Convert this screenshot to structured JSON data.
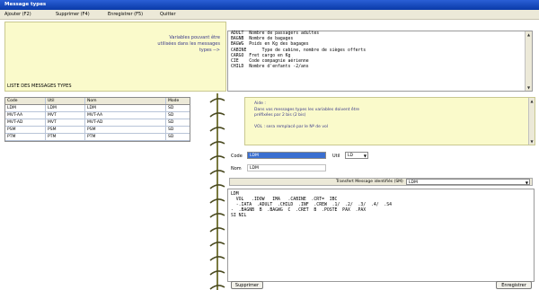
{
  "window": {
    "title": "Message types"
  },
  "menu": [
    "Ajouter (F2)",
    "Supprimer (F4)",
    "Enregistrer (F5)",
    "Quitter"
  ],
  "info": {
    "text_lines": [
      "Variables pouvant être",
      "utilisées dans les messages",
      "types -->"
    ],
    "list_label": "LISTE DES MESSAGES TYPES"
  },
  "grid": {
    "headers": [
      "Code",
      "Util",
      "Nom",
      "Mode"
    ],
    "rows": [
      [
        "LDM",
        "LDM",
        "LDM",
        "SD"
      ],
      [
        "MVT-AA",
        "MVT",
        "MVT-AA",
        "SD"
      ],
      [
        "MVT-AD",
        "MVT",
        "MVT-AD",
        "SD"
      ],
      [
        "PSM",
        "PSM",
        "PSM",
        "SD"
      ],
      [
        "PTM",
        "PTM",
        "PTM",
        "SD"
      ]
    ]
  },
  "variables": [
    "ADULT  Nombre de passagers adultes",
    "BAGNB  Nombre de bagages",
    "BAGWG  Poids en Kg des bagages",
    "CABINE      Type de cabine, nombre de sièges offerts",
    "CARGO  Fret cargo en Kg",
    "CIE    Code compagnie aérienne",
    "CHILD  Nombre d'enfants -2/ans"
  ],
  "note": {
    "lines": [
      "Aide :",
      "Dans vos messages types les variables doivent être",
      "préfixées par 2 bis (2 bis)",
      "",
      "VOL : sera remplacé par le Nº de vol"
    ]
  },
  "form": {
    "code_label": "Code",
    "code_value": "LDM",
    "util_label": "Util",
    "util_value": "LD",
    "nom_label": "Nom",
    "nom_value": "LDM",
    "dropdown_label": "Transfert Message identifiés (SM)",
    "dropdown_value": "LDM"
  },
  "message_lines": [
    "LDM",
    "  VOL   .IDOW   IMA   .CABINE  .CRT=  IBC",
    "  -.IATA  .ADULT  .CHILD  .INF  .CREW  .1/  .2/  .3/  .4/  .S4",
    "-  .BAGNB  B  .BAGWG  C  .CRET  B  .POSTE  PAX  .PAX",
    "SI NIL"
  ],
  "buttons": {
    "delete": "Supprimer",
    "save": "Enregistrer"
  }
}
